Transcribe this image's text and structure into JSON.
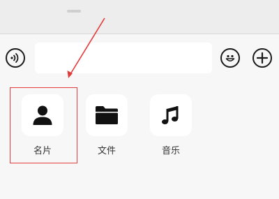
{
  "input_bar": {
    "voice_icon": "voice-wave-icon",
    "input_value": "",
    "emoji_icon": "smiley-face-icon",
    "plus_icon": "plus-icon"
  },
  "panel": {
    "items": [
      {
        "label": "名片",
        "icon": "person-silhouette-icon"
      },
      {
        "label": "文件",
        "icon": "folder-icon"
      },
      {
        "label": "音乐",
        "icon": "music-note-icon"
      }
    ]
  },
  "annotation": {
    "color": "#e23b3b"
  }
}
